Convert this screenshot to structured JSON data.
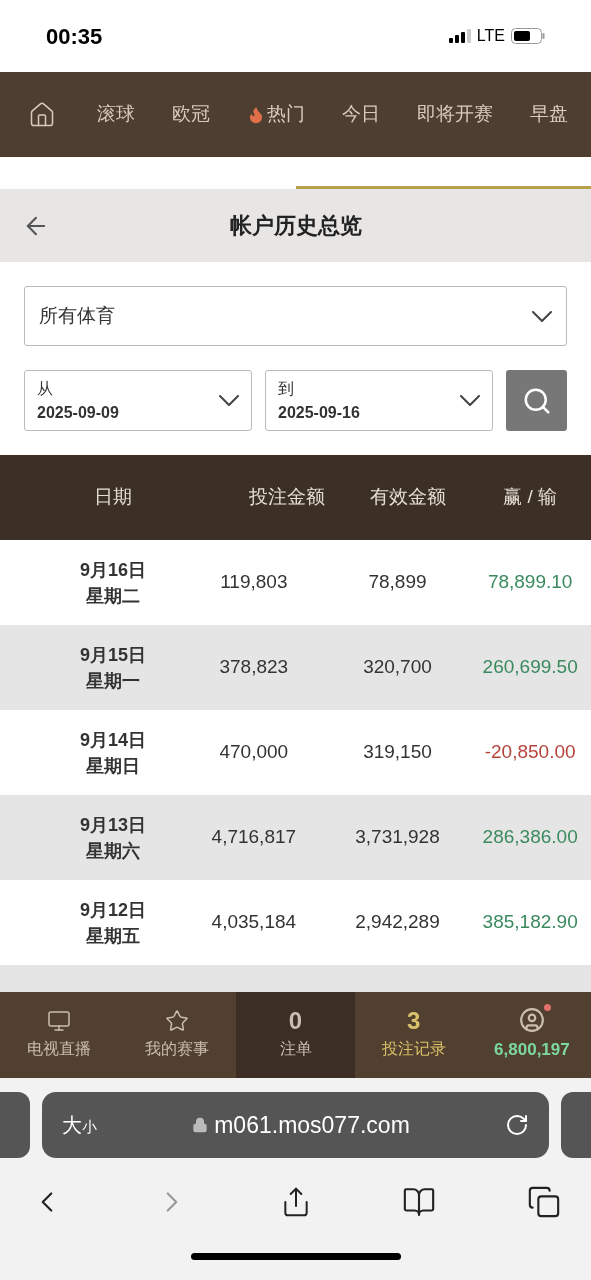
{
  "status_bar": {
    "time": "00:35",
    "network": "LTE"
  },
  "nav": {
    "items": [
      {
        "label": "滚球",
        "hot": false
      },
      {
        "label": "欧冠",
        "hot": false
      },
      {
        "label": "热门",
        "hot": true
      },
      {
        "label": "今日",
        "hot": false
      },
      {
        "label": "即将开赛",
        "hot": false
      },
      {
        "label": "早盘",
        "hot": false
      }
    ]
  },
  "header": {
    "title": "帐户历史总览"
  },
  "filters": {
    "sport": "所有体育",
    "from": {
      "label": "从",
      "value": "2025-09-09"
    },
    "to": {
      "label": "到",
      "value": "2025-09-16"
    }
  },
  "table": {
    "columns": [
      "日期",
      "投注金额",
      "有效金额",
      "赢 / 输"
    ],
    "rows": [
      {
        "date": "9月16日",
        "weekday": "星期二",
        "stake": "119,803",
        "valid": "78,899",
        "result": "78,899.10",
        "win": true
      },
      {
        "date": "9月15日",
        "weekday": "星期一",
        "stake": "378,823",
        "valid": "320,700",
        "result": "260,699.50",
        "win": true
      },
      {
        "date": "9月14日",
        "weekday": "星期日",
        "stake": "470,000",
        "valid": "319,150",
        "result": "-20,850.00",
        "win": false
      },
      {
        "date": "9月13日",
        "weekday": "星期六",
        "stake": "4,716,817",
        "valid": "3,731,928",
        "result": "286,386.00",
        "win": true
      },
      {
        "date": "9月12日",
        "weekday": "星期五",
        "stake": "4,035,184",
        "valid": "2,942,289",
        "result": "385,182.90",
        "win": true
      }
    ]
  },
  "bottom_nav": [
    {
      "kind": "tv",
      "label": "电视直播"
    },
    {
      "kind": "star",
      "label": "我的赛事"
    },
    {
      "kind": "count",
      "value": "0",
      "label": "注单",
      "selected": true
    },
    {
      "kind": "count",
      "value": "3",
      "label": "投注记录",
      "selected": false
    },
    {
      "kind": "account",
      "value": "6,800,197",
      "notify": true
    }
  ],
  "browser": {
    "text_size": "大",
    "text_size_small": "小",
    "url": "m061.mos077.com"
  }
}
